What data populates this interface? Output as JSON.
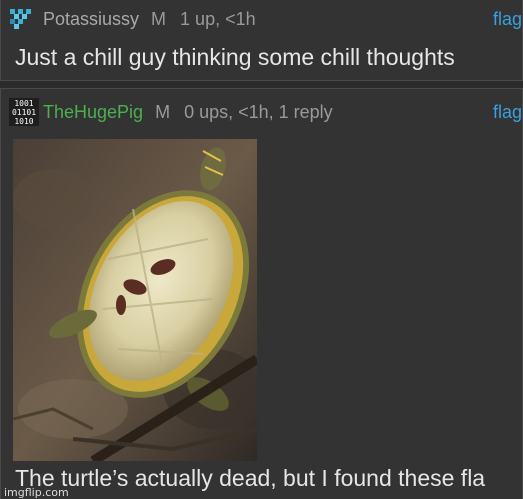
{
  "comment1": {
    "username": "Potassiussy",
    "badge": "M",
    "stats": "1 up, <1h",
    "flag_label": "flag",
    "text": "Just a chill guy thinking some chill thoughts",
    "avatar_icon": "pixel-heart-icon"
  },
  "comment2": {
    "username": "TheHugePig",
    "badge": "M",
    "stats": "0 ups, <1h, 1 reply",
    "flag_label": "flag",
    "avatar_icon": "binary-digits-icon",
    "avatar_text": [
      "1001",
      "01101",
      "1010"
    ],
    "image_icon": "turtle-photo",
    "caption": "The turtle’s actually dead, but I found these fla"
  },
  "watermark": "imgflip.com",
  "colors": {
    "background": "#2b2b2b",
    "card": "#333333",
    "link": "#3aa0e0",
    "username_green": "#4caf50",
    "text": "#e6e6e6",
    "meta": "#9a9a9a"
  }
}
